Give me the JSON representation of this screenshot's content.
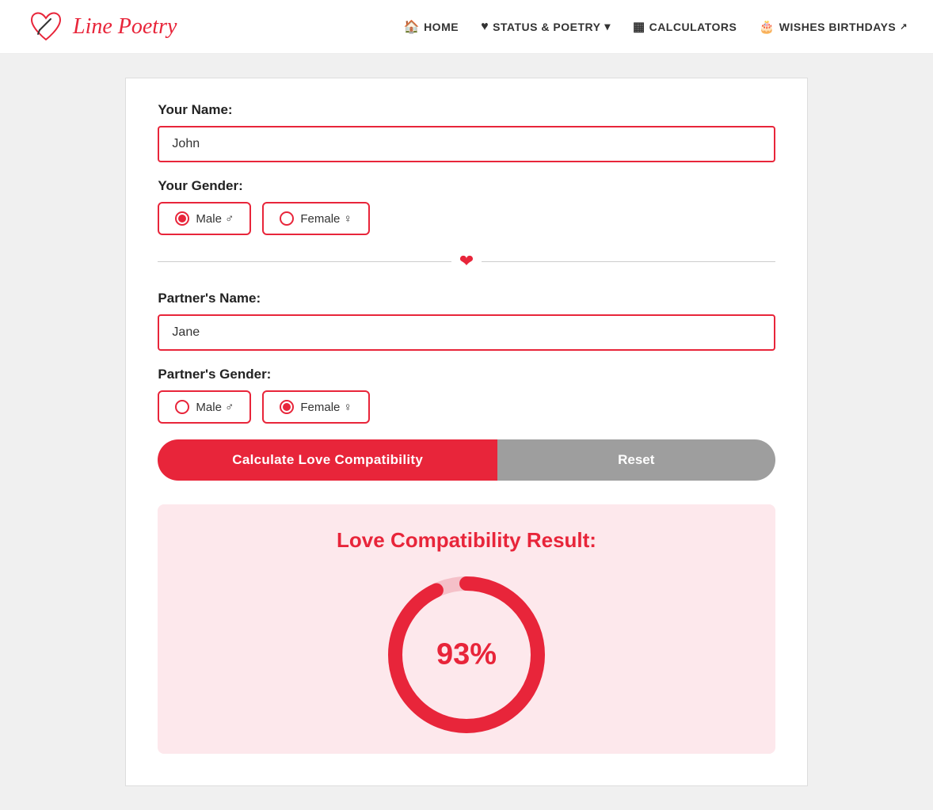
{
  "navbar": {
    "logo_text": "Line Poetry",
    "links": [
      {
        "id": "home",
        "icon": "🏠",
        "label": "HOME",
        "has_arrow": false
      },
      {
        "id": "status-poetry",
        "icon": "♥",
        "label": "STATUS & POETRY",
        "has_arrow": true
      },
      {
        "id": "calculators",
        "icon": "▦",
        "label": "CALCULATORS",
        "has_arrow": false
      },
      {
        "id": "wishes-birthdays",
        "icon": "🎂",
        "label": "WISHES BIRTHDAYS",
        "has_arrow": false,
        "external": true
      }
    ]
  },
  "form": {
    "your_name_label": "Your Name:",
    "your_name_value": "John",
    "your_name_placeholder": "",
    "your_gender_label": "Your Gender:",
    "your_gender_options": [
      {
        "id": "male",
        "label": "Male ♂",
        "selected": true
      },
      {
        "id": "female",
        "label": "Female ♀",
        "selected": false
      }
    ],
    "partner_name_label": "Partner's Name:",
    "partner_name_value": "Jane",
    "partner_name_placeholder": "",
    "partner_gender_label": "Partner's Gender:",
    "partner_gender_options": [
      {
        "id": "male",
        "label": "Male ♂",
        "selected": false
      },
      {
        "id": "female",
        "label": "Female ♀",
        "selected": true
      }
    ],
    "calculate_button": "Calculate Love Compatibility",
    "reset_button": "Reset"
  },
  "result": {
    "title": "Love Compatibility Result:",
    "percentage": "93%",
    "percentage_num": 93
  }
}
